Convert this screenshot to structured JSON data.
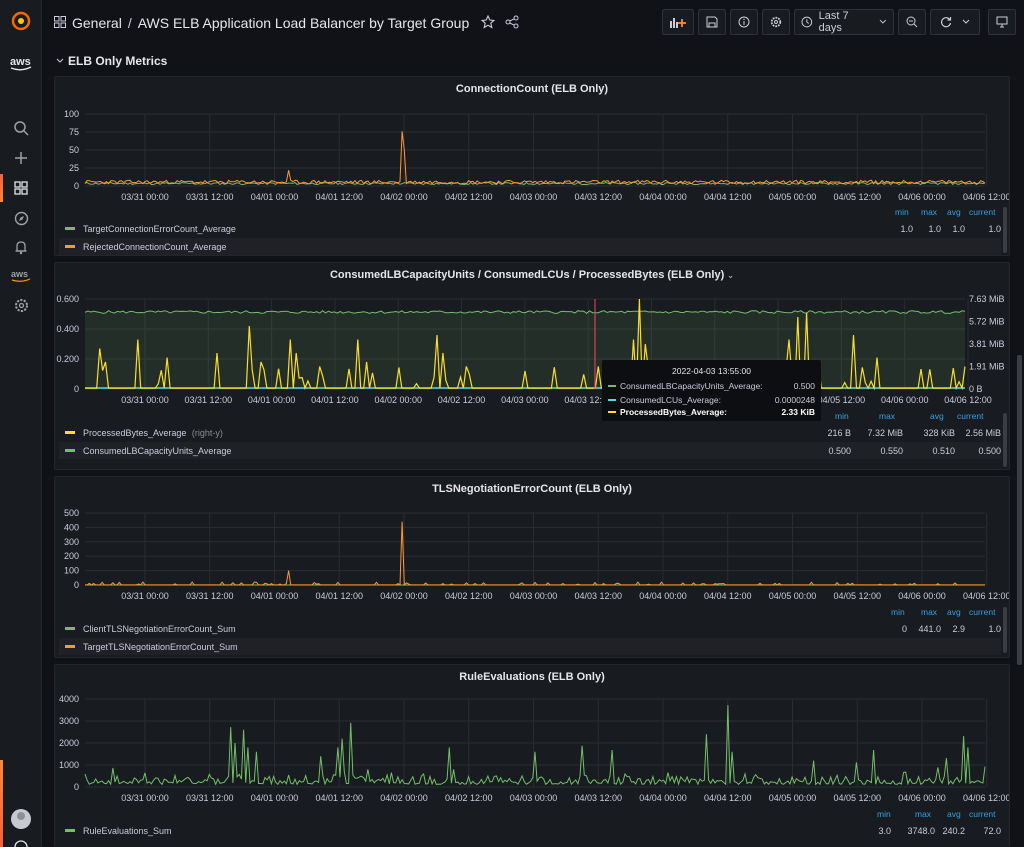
{
  "breadcrumb": {
    "folder": "General",
    "separator": "/",
    "dashboard": "AWS ELB Application Load Balancer by Target Group"
  },
  "toolbar": {
    "time_range": "Last 7 days"
  },
  "row": {
    "title": "ELB Only Metrics"
  },
  "x_ticks": [
    "03/31 00:00",
    "03/31 12:00",
    "04/01 00:00",
    "04/01 12:00",
    "04/02 00:00",
    "04/02 12:00",
    "04/03 00:00",
    "04/03 12:00",
    "04/04 00:00",
    "04/04 12:00",
    "04/05 00:00",
    "04/05 12:00",
    "04/06 00:00",
    "04/06 12:00"
  ],
  "colors": {
    "green": "#73bf69",
    "orange": "#ff9830",
    "yellow": "#fade2a",
    "blue": "#5794f2",
    "cyan": "#5ad8e6",
    "accent": "#33a2e5"
  },
  "panels": {
    "connection": {
      "title": "ConnectionCount (ELB Only)",
      "y_ticks": [
        "100",
        "75",
        "50",
        "25",
        "0"
      ],
      "legend_headers": [
        "min",
        "max",
        "avg",
        "current"
      ],
      "series": [
        {
          "name": "TargetConnectionErrorCount_Average",
          "color": "#73bf69",
          "min": "1.0",
          "max": "1.0",
          "avg": "1.0",
          "current": "1.0"
        },
        {
          "name": "RejectedConnectionCount_Average",
          "color": "#ff9830",
          "min": "",
          "max": "",
          "avg": "",
          "current": ""
        }
      ]
    },
    "lcu": {
      "title": "ConsumedLBCapacityUnits / ConsumedLCUs / ProcessedBytes (ELB Only)",
      "y_ticks_left": [
        "0.600",
        "0.400",
        "0.200",
        "0"
      ],
      "y_ticks_right": [
        "7.63 MiB",
        "5.72 MiB",
        "3.81 MiB",
        "1.91 MiB",
        "0 B"
      ],
      "legend_headers": [
        "min",
        "max",
        "avg",
        "current"
      ],
      "series": [
        {
          "name": "ProcessedBytes_Average",
          "suffix": "(right-y)",
          "color": "#fade2a",
          "min": "216 B",
          "max": "7.32 MiB",
          "avg": "328 KiB",
          "current": "2.56 MiB"
        },
        {
          "name": "ConsumedLBCapacityUnits_Average",
          "suffix": "",
          "color": "#73bf69",
          "min": "0.500",
          "max": "0.550",
          "avg": "0.510",
          "current": "0.500"
        }
      ],
      "tooltip": {
        "time": "2022-04-03 13:55:00",
        "rows": [
          {
            "name": "ConsumedLBCapacityUnits_Average:",
            "value": "0.500",
            "color": "#73bf69"
          },
          {
            "name": "ConsumedLCUs_Average:",
            "value": "0.0000248",
            "color": "#5ad8e6"
          },
          {
            "name": "ProcessedBytes_Average:",
            "value": "2.33 KiB",
            "color": "#fade2a"
          }
        ]
      }
    },
    "tls": {
      "title": "TLSNegotiationErrorCount (ELB Only)",
      "y_ticks": [
        "500",
        "400",
        "300",
        "200",
        "100",
        "0"
      ],
      "legend_headers": [
        "min",
        "max",
        "avg",
        "current"
      ],
      "series": [
        {
          "name": "ClientTLSNegotiationErrorCount_Sum",
          "color": "#73bf69",
          "min": "0",
          "max": "441.0",
          "avg": "2.9",
          "current": "1.0"
        },
        {
          "name": "TargetTLSNegotiationErrorCount_Sum",
          "color": "#ff9830",
          "min": "",
          "max": "",
          "avg": "",
          "current": ""
        }
      ]
    },
    "rules": {
      "title": "RuleEvaluations (ELB Only)",
      "y_ticks": [
        "4000",
        "3000",
        "2000",
        "1000",
        "0"
      ],
      "legend_headers": [
        "min",
        "max",
        "avg",
        "current"
      ],
      "series": [
        {
          "name": "RuleEvaluations_Sum",
          "color": "#73bf69",
          "min": "3.0",
          "max": "3748.0",
          "avg": "240.2",
          "current": "72.0"
        }
      ]
    }
  }
}
